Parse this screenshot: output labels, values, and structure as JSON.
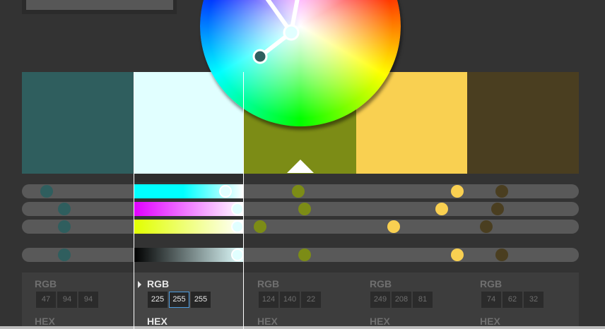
{
  "colors": [
    {
      "hex": "#2F5E5E",
      "r": "47",
      "g": "94",
      "b": "94"
    },
    {
      "hex": "#E1FFFF",
      "r": "225",
      "g": "255",
      "b": "255"
    },
    {
      "hex": "#7C8C16",
      "r": "124",
      "g": "140",
      "b": "22"
    },
    {
      "hex": "#F9D051",
      "r": "249",
      "g": "208",
      "b": "81"
    },
    {
      "hex": "#4A3E20",
      "r": "74",
      "g": "62",
      "b": "32"
    }
  ],
  "selected_index": 1,
  "labels": {
    "rgb": "RGB",
    "hex": "HEX"
  },
  "icons": {
    "selected_arrow": "triangle-up-icon",
    "expand": "triangle-right-icon"
  }
}
